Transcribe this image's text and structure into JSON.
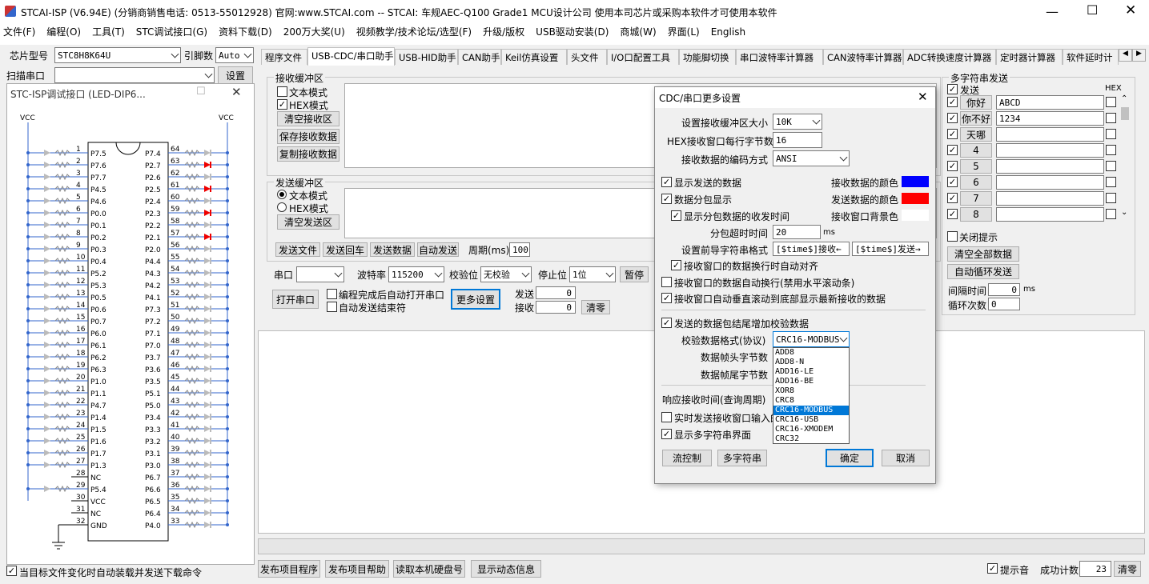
{
  "window": {
    "title": "STCAI-ISP (V6.94E) (分销商销售电话: 0513-55012928) 官网:www.STCAI.com  -- STCAI: 车规AEC-Q100 Grade1 MCU设计公司 使用本司芯片或采购本软件才可使用本软件"
  },
  "menu": [
    "文件(F)",
    "编程(O)",
    "工具(T)",
    "STC调试接口(G)",
    "资料下载(D)",
    "200万大奖(U)",
    "视频教学/技术论坛/选型(F)",
    "升级/版权",
    "USB驱动安装(D)",
    "商城(W)",
    "界面(L)",
    "English"
  ],
  "left": {
    "chip_label": "芯片型号",
    "chip_value": "STC8H8K64U",
    "pins_label": "引脚数",
    "pins_value": "Auto",
    "scan_label": "扫描串口",
    "settings_btn": "设置",
    "debug_title": "STC-ISP调试接口 (LED-DIP6...",
    "vcc_left": "VCC",
    "vcc_right": "VCC",
    "pins": [
      {
        "ln": "1",
        "lname": "P7.5",
        "rname": "P7.4",
        "rn": "64",
        "red": false
      },
      {
        "ln": "2",
        "lname": "P7.6",
        "rname": "P2.7",
        "rn": "63",
        "red": true
      },
      {
        "ln": "3",
        "lname": "P7.7",
        "rname": "P2.6",
        "rn": "62",
        "red": false
      },
      {
        "ln": "4",
        "lname": "P4.5",
        "rname": "P2.5",
        "rn": "61",
        "red": true
      },
      {
        "ln": "5",
        "lname": "P4.6",
        "rname": "P2.4",
        "rn": "60",
        "red": false
      },
      {
        "ln": "6",
        "lname": "P0.0",
        "rname": "P2.3",
        "rn": "59",
        "red": true
      },
      {
        "ln": "7",
        "lname": "P0.1",
        "rname": "P2.2",
        "rn": "58",
        "red": false
      },
      {
        "ln": "8",
        "lname": "P0.2",
        "rname": "P2.1",
        "rn": "57",
        "red": true
      },
      {
        "ln": "9",
        "lname": "P0.3",
        "rname": "P2.0",
        "rn": "56",
        "red": false
      },
      {
        "ln": "10",
        "lname": "P0.4",
        "rname": "P4.4",
        "rn": "55",
        "red": false
      },
      {
        "ln": "11",
        "lname": "P5.2",
        "rname": "P4.3",
        "rn": "54",
        "red": false
      },
      {
        "ln": "12",
        "lname": "P5.3",
        "rname": "P4.2",
        "rn": "53",
        "red": false
      },
      {
        "ln": "13",
        "lname": "P0.5",
        "rname": "P4.1",
        "rn": "52",
        "red": false
      },
      {
        "ln": "14",
        "lname": "P0.6",
        "rname": "P7.3",
        "rn": "51",
        "red": false
      },
      {
        "ln": "15",
        "lname": "P0.7",
        "rname": "P7.2",
        "rn": "50",
        "red": false
      },
      {
        "ln": "16",
        "lname": "P6.0",
        "rname": "P7.1",
        "rn": "49",
        "red": false
      },
      {
        "ln": "17",
        "lname": "P6.1",
        "rname": "P7.0",
        "rn": "48",
        "red": false
      },
      {
        "ln": "18",
        "lname": "P6.2",
        "rname": "P3.7",
        "rn": "47",
        "red": false
      },
      {
        "ln": "19",
        "lname": "P6.3",
        "rname": "P3.6",
        "rn": "46",
        "red": false
      },
      {
        "ln": "20",
        "lname": "P1.0",
        "rname": "P3.5",
        "rn": "45",
        "red": false
      },
      {
        "ln": "21",
        "lname": "P1.1",
        "rname": "P5.1",
        "rn": "44",
        "red": false
      },
      {
        "ln": "22",
        "lname": "P4.7",
        "rname": "P5.0",
        "rn": "43",
        "red": false
      },
      {
        "ln": "23",
        "lname": "P1.4",
        "rname": "P3.4",
        "rn": "42",
        "red": false
      },
      {
        "ln": "24",
        "lname": "P1.5",
        "rname": "P3.3",
        "rn": "41",
        "red": false
      },
      {
        "ln": "25",
        "lname": "P1.6",
        "rname": "P3.2",
        "rn": "40",
        "red": false
      },
      {
        "ln": "26",
        "lname": "P1.7",
        "rname": "P3.1",
        "rn": "39",
        "red": false
      },
      {
        "ln": "27",
        "lname": "P1.3",
        "rname": "P3.0",
        "rn": "38",
        "red": false
      },
      {
        "ln": "28",
        "lname": "NC",
        "rname": "P6.7",
        "rn": "37",
        "red": false
      },
      {
        "ln": "29",
        "lname": "P5.4",
        "rname": "P6.6",
        "rn": "36",
        "red": false
      },
      {
        "ln": "30",
        "lname": "VCC",
        "rname": "P6.5",
        "rn": "35",
        "red": false
      },
      {
        "ln": "31",
        "lname": "NC",
        "rname": "P6.4",
        "rn": "34",
        "red": false
      },
      {
        "ln": "32",
        "lname": "GND",
        "rname": "P4.0",
        "rn": "33",
        "red": false
      }
    ],
    "auto_reload": "当目标文件变化时自动装载并发送下载命令"
  },
  "tabs": [
    "程序文件",
    "USB-CDC/串口助手",
    "USB-HID助手",
    "CAN助手",
    "Keil仿真设置",
    "头文件",
    "I/O口配置工具",
    "功能脚切换",
    "串口波特率计算器",
    "CAN波特率计算器",
    "ADC转换速度计算器",
    "定时器计算器",
    "软件延时计"
  ],
  "recv": {
    "title": "接收缓冲区",
    "text_mode": "文本模式",
    "hex_mode": "HEX模式",
    "clear": "清空接收区",
    "save": "保存接收数据",
    "copy": "复制接收数据"
  },
  "send": {
    "title": "发送缓冲区",
    "text_mode": "文本模式",
    "hex_mode": "HEX模式",
    "clear": "清空发送区",
    "send_file": "发送文件",
    "send_back": "发送回车",
    "send_data": "发送数据",
    "auto_send": "自动发送",
    "period_label": "周期(ms)",
    "period_value": "100"
  },
  "port": {
    "port_label": "串口",
    "baud_label": "波特率",
    "baud_value": "115200",
    "parity_label": "校验位",
    "parity_value": "无校验",
    "stop_label": "停止位",
    "stop_value": "1位",
    "pause": "暂停",
    "open": "打开串口",
    "auto_open": "编程完成后自动打开串口",
    "auto_end": "自动发送结束符",
    "more": "更多设置",
    "tx_label": "发送",
    "tx_value": "0",
    "rx_label": "接收",
    "rx_value": "0",
    "clear": "清零"
  },
  "multi": {
    "title": "多字符串发送",
    "send_label": "发送",
    "hex_label": "HEX",
    "rows": [
      {
        "btn": "你好",
        "val": "ABCD"
      },
      {
        "btn": "你不好",
        "val": "1234"
      },
      {
        "btn": "天哪",
        "val": ""
      },
      {
        "btn": "4",
        "val": ""
      },
      {
        "btn": "5",
        "val": ""
      },
      {
        "btn": "6",
        "val": ""
      },
      {
        "btn": "7",
        "val": ""
      },
      {
        "btn": "8",
        "val": ""
      }
    ],
    "close_hint": "关闭提示",
    "clear_all": "清空全部数据",
    "auto_loop": "自动循环发送",
    "interval_label": "间隔时间",
    "interval_value": "0",
    "interval_unit": "ms",
    "loop_label": "循环次数",
    "loop_value": "0"
  },
  "dialog": {
    "title": "CDC/串口更多设置",
    "buf_size_label": "设置接收缓冲区大小",
    "buf_size_value": "10K",
    "hex_bytes_label": "HEX接收窗口每行字节数",
    "hex_bytes_value": "16",
    "encoding_label": "接收数据的编码方式",
    "encoding_value": "ANSI",
    "show_sent": "显示发送的数据",
    "recv_color_label": "接收数据的颜色",
    "recv_color": "#0000ff",
    "packet_show": "数据分包显示",
    "send_color_label": "发送数据的颜色",
    "send_color": "#ff0000",
    "packet_time": "显示分包数据的收发时间",
    "bg_color_label": "接收窗口背景色",
    "bg_color": "#ffffff",
    "timeout_label": "分包超时时间",
    "timeout_value": "20",
    "timeout_unit": "ms",
    "prefix_label": "设置前导字符串格式",
    "prefix_recv": "[$time$]接收←",
    "prefix_send": "[$time$]发送→",
    "align": "接收窗口的数据换行时自动对齐",
    "auto_wrap": "接收窗口的数据自动换行(禁用水平滚动条)",
    "auto_scroll": "接收窗口自动垂直滚动到底部显示最新接收的数据",
    "checksum": "发送的数据包结尾增加校验数据",
    "checksum_fmt_label": "校验数据格式(协议)",
    "checksum_fmt_value": "CRC16-MODBUS",
    "frame_head_label": "数据帧头字节数",
    "frame_tail_label": "数据帧尾字节数",
    "resp_label": "响应接收时间(查询周期)",
    "realtime": "实时发送接收窗口输入的",
    "show_multi": "显示多字符串界面",
    "flow": "流控制",
    "multi_btn": "多字符串",
    "ok": "确定",
    "cancel": "取消",
    "options": [
      "ADD8",
      "ADD8-N",
      "ADD16-LE",
      "ADD16-BE",
      "XOR8",
      "CRC8",
      "CRC16-MODBUS",
      "CRC16-USB",
      "CRC16-XMODEM",
      "CRC32"
    ],
    "selected_index": 6
  },
  "bottom": {
    "publish": "发布项目程序",
    "publish_help": "发布项目帮助",
    "read_disk": "读取本机硬盘号",
    "show_info": "显示动态信息",
    "beep": "提示音",
    "success_label": "成功计数",
    "success_value": "23",
    "clear": "清零"
  }
}
